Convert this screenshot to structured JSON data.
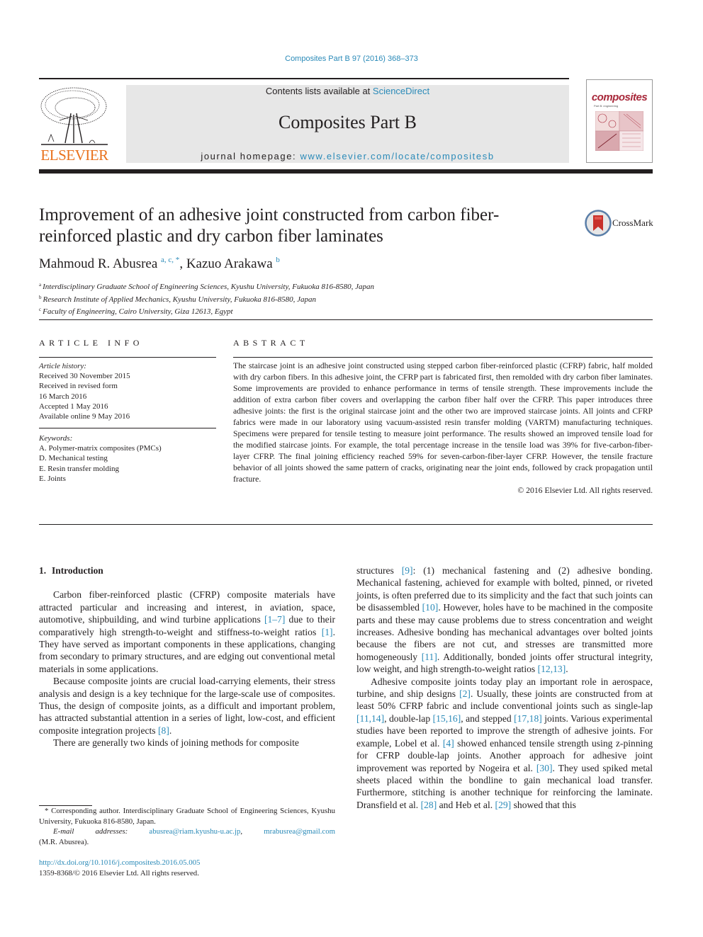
{
  "header": {
    "citation": "Composites Part B 97 (2016) 368–373",
    "publisher_logo": "ELSEVIER",
    "contents_prefix": "Contents lists available at ",
    "contents_link": "ScienceDirect",
    "journal_title": "Composites Part B",
    "homepage_prefix": "journal homepage: ",
    "homepage_link": "www.elsevier.com/locate/compositesb",
    "cover_word": "composites",
    "cover_subtitle": "Part B: engineering"
  },
  "article": {
    "title": "Improvement of an adhesive joint constructed from carbon fiber-reinforced plastic and dry carbon fiber laminates",
    "crossmark_label": "CrossMark",
    "authors": [
      {
        "name": "Mahmoud R. Abusrea",
        "sup": "a, c, *"
      },
      {
        "name": "Kazuo Arakawa",
        "sup": "b"
      }
    ],
    "author_separator": ", ",
    "affiliations": [
      {
        "key": "a",
        "text": "Interdisciplinary Graduate School of Engineering Sciences, Kyushu University, Fukuoka 816-8580, Japan"
      },
      {
        "key": "b",
        "text": "Research Institute of Applied Mechanics, Kyushu University, Fukuoka 816-8580, Japan"
      },
      {
        "key": "c",
        "text": "Faculty of Engineering, Cairo University, Giza 12613, Egypt"
      }
    ]
  },
  "article_info": {
    "heading": "ARTICLE INFO",
    "history_label": "Article history:",
    "history": [
      "Received 30 November 2015",
      "Received in revised form",
      "16 March 2016",
      "Accepted 1 May 2016",
      "Available online 9 May 2016"
    ],
    "keywords_label": "Keywords:",
    "keywords": [
      "A. Polymer-matrix composites (PMCs)",
      "D. Mechanical testing",
      "E. Resin transfer molding",
      "E. Joints"
    ]
  },
  "abstract": {
    "heading": "ABSTRACT",
    "text": "The staircase joint is an adhesive joint constructed using stepped carbon fiber-reinforced plastic (CFRP) fabric, half molded with dry carbon fibers. In this adhesive joint, the CFRP part is fabricated first, then remolded with dry carbon fiber laminates. Some improvements are provided to enhance performance in terms of tensile strength. These improvements include the addition of extra carbon fiber covers and overlapping the carbon fiber half over the CFRP. This paper introduces three adhesive joints: the first is the original staircase joint and the other two are improved staircase joints. All joints and CFRP fabrics were made in our laboratory using vacuum-assisted resin transfer molding (VARTM) manufacturing techniques. Specimens were prepared for tensile testing to measure joint performance. The results showed an improved tensile load for the modified staircase joints. For example, the total percentage increase in the tensile load was 39% for five-carbon-fiber-layer CFRP. The final joining efficiency reached 59% for seven-carbon-fiber-layer CFRP. However, the tensile fracture behavior of all joints showed the same pattern of cracks, originating near the joint ends, followed by crack propagation until fracture.",
    "copyright": "© 2016 Elsevier Ltd. All rights reserved."
  },
  "introduction": {
    "number": "1.",
    "heading": "Introduction",
    "left_paragraphs": [
      [
        {
          "t": "Carbon fiber-reinforced plastic (CFRP) composite materials have attracted particular and increasing and interest, in aviation, space, automotive, shipbuilding, and wind turbine applications "
        },
        {
          "ref": "[1–7]"
        },
        {
          "t": " due to their comparatively high strength-to-weight and stiffness-to-weight ratios "
        },
        {
          "ref": "[1]"
        },
        {
          "t": ". They have served as important components in these applications, changing from secondary to primary structures, and are edging out conventional metal materials in some applications."
        }
      ],
      [
        {
          "t": "Because composite joints are crucial load-carrying elements, their stress analysis and design is a key technique for the large-scale use of composites. Thus, the design of composite joints, as a difficult and important problem, has attracted substantial attention in a series of light, low-cost, and efficient composite integration projects "
        },
        {
          "ref": "[8]"
        },
        {
          "t": "."
        }
      ],
      [
        {
          "t": "There are generally two kinds of joining methods for composite"
        }
      ]
    ],
    "right_paragraphs": [
      [
        {
          "t": "structures "
        },
        {
          "ref": "[9]"
        },
        {
          "t": ": (1) mechanical fastening and (2) adhesive bonding. Mechanical fastening, achieved for example with bolted, pinned, or riveted joints, is often preferred due to its simplicity and the fact that such joints can be disassembled "
        },
        {
          "ref": "[10]"
        },
        {
          "t": ". However, holes have to be machined in the composite parts and these may cause problems due to stress concentration and weight increases. Adhesive bonding has mechanical advantages over bolted joints because the fibers are not cut, and stresses are transmitted more homogeneously "
        },
        {
          "ref": "[11]"
        },
        {
          "t": ". Additionally, bonded joints offer structural integrity, low weight, and high strength-to-weight ratios "
        },
        {
          "ref": "[12,13]"
        },
        {
          "t": "."
        }
      ],
      [
        {
          "t": "Adhesive composite joints today play an important role in aerospace, turbine, and ship designs "
        },
        {
          "ref": "[2]"
        },
        {
          "t": ". Usually, these joints are constructed from at least 50% CFRP fabric and include conventional joints such as single-lap "
        },
        {
          "ref": "[11,14]"
        },
        {
          "t": ", double-lap "
        },
        {
          "ref": "[15,16]"
        },
        {
          "t": ", and stepped "
        },
        {
          "ref": "[17,18]"
        },
        {
          "t": " joints. Various experimental studies have been reported to improve the strength of adhesive joints. For example, Lobel et al. "
        },
        {
          "ref": "[4]"
        },
        {
          "t": " showed enhanced tensile strength using z-pinning for CFRP double-lap joints. Another approach for adhesive joint improvement was reported by Nogeira et al. "
        },
        {
          "ref": "[30]"
        },
        {
          "t": ". They used spiked metal sheets placed within the bondline to gain mechanical load transfer. Furthermore, stitching is another technique for reinforcing the laminate. Dransfield et al. "
        },
        {
          "ref": "[28]"
        },
        {
          "t": " and Heb et al. "
        },
        {
          "ref": "[29]"
        },
        {
          "t": " showed that this"
        }
      ]
    ]
  },
  "footnote": {
    "corresponding": "* Corresponding author. Interdisciplinary Graduate School of Engineering Sciences, Kyushu University, Fukuoka 816-8580, Japan.",
    "email_label": "E-mail addresses:",
    "email_1": "abusrea@riam.kyushu-u.ac.jp",
    "email_sep": ", ",
    "email_2": "mrabusrea@gmail.com",
    "email_owner": "(M.R. Abusrea).",
    "doi": "http://dx.doi.org/10.1016/j.compositesb.2016.05.005",
    "issn": "1359-8368/© 2016 Elsevier Ltd. All rights reserved."
  },
  "colors": {
    "link": "#2a8ab8",
    "elsevier_orange": "#e9711c",
    "banner_gray": "#e7e7e7",
    "cover_red": "#a8283a",
    "text": "#231f20"
  }
}
